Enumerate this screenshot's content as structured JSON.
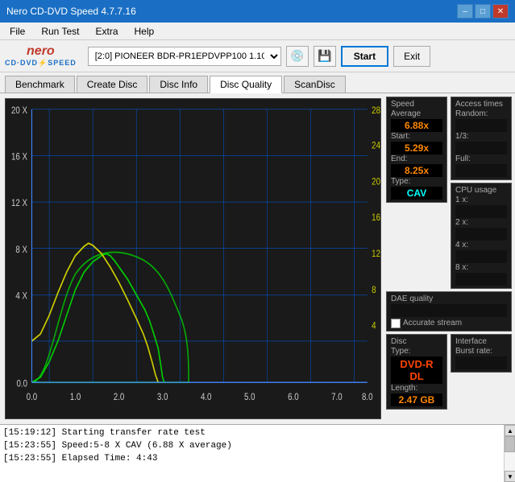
{
  "titlebar": {
    "title": "Nero CD-DVD Speed 4.7.7.16",
    "min": "–",
    "max": "□",
    "close": "✕"
  },
  "menu": {
    "items": [
      "File",
      "Run Test",
      "Extra",
      "Help"
    ]
  },
  "toolbar": {
    "logo_nero": "nero",
    "logo_sub": "CD•DVD⚡SPEED",
    "drive": "[2:0]  PIONEER BDR-PR1EPDVPP100 1.10",
    "start_label": "Start",
    "exit_label": "Exit"
  },
  "tabs": [
    {
      "label": "Benchmark",
      "active": false
    },
    {
      "label": "Create Disc",
      "active": false
    },
    {
      "label": "Disc Info",
      "active": false
    },
    {
      "label": "Disc Quality",
      "active": true
    },
    {
      "label": "ScanDisc",
      "active": false
    }
  ],
  "stats": {
    "speed": {
      "label": "Speed",
      "average_label": "Average",
      "average_value": "6.88x",
      "start_label": "Start:",
      "start_value": "5.29x",
      "end_label": "End:",
      "end_value": "8.25x",
      "type_label": "Type:",
      "type_value": "CAV"
    },
    "access_times": {
      "label": "Access times",
      "random_label": "Random:",
      "random_value": "",
      "onethird_label": "1/3:",
      "onethird_value": "",
      "full_label": "Full:",
      "full_value": ""
    },
    "cpu": {
      "label": "CPU usage",
      "1x_label": "1 x:",
      "1x_value": "",
      "2x_label": "2 x:",
      "2x_value": "",
      "4x_label": "4 x:",
      "4x_value": "",
      "8x_label": "8 x:",
      "8x_value": ""
    },
    "dae": {
      "label": "DAE quality",
      "value": ""
    },
    "accurate": {
      "label": "Accurate",
      "label2": "stream",
      "checked": false
    },
    "disc": {
      "label": "Disc",
      "label2": "Type:",
      "type_value": "DVD-R DL",
      "length_label": "Length:",
      "length_value": "2.47 GB"
    },
    "interface": {
      "label": "Interface",
      "burst_label": "Burst rate:",
      "burst_value": ""
    }
  },
  "log": {
    "entries": [
      "[15:19:12]  Starting transfer rate test",
      "[15:23:55]  Speed:5-8 X CAV (6.88 X average)",
      "[15:23:55]  Elapsed Time: 4:43"
    ]
  },
  "chart": {
    "y_left_labels": [
      "20 X",
      "16 X",
      "12 X",
      "8 X",
      "4 X",
      "0.0"
    ],
    "y_right_labels": [
      "28",
      "24",
      "20",
      "16",
      "12",
      "8",
      "4"
    ],
    "x_labels": [
      "0.0",
      "1.0",
      "2.0",
      "3.0",
      "4.0",
      "5.0",
      "6.0",
      "7.0",
      "8.0"
    ]
  }
}
